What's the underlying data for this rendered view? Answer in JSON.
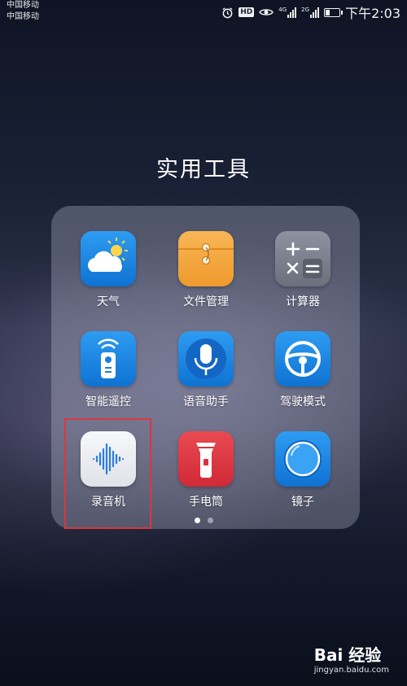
{
  "status_bar": {
    "carrier_1": "中国移动",
    "carrier_2": "中国移动",
    "hd": "HD",
    "net_1": "4G",
    "net_2": "2G",
    "time": "下午2:03",
    "battery_level": 0.35
  },
  "folder": {
    "title": "实用工具",
    "apps": [
      {
        "label": "天气",
        "icon": "weather-icon"
      },
      {
        "label": "文件管理",
        "icon": "file-manager-icon"
      },
      {
        "label": "计算器",
        "icon": "calculator-icon"
      },
      {
        "label": "智能遥控",
        "icon": "remote-control-icon"
      },
      {
        "label": "语音助手",
        "icon": "microphone-icon"
      },
      {
        "label": "驾驶模式",
        "icon": "steering-wheel-icon"
      },
      {
        "label": "录音机",
        "icon": "sound-recorder-icon"
      },
      {
        "label": "手电筒",
        "icon": "flashlight-icon"
      },
      {
        "label": "镜子",
        "icon": "mirror-icon"
      }
    ],
    "page_count": 2,
    "current_page": 1
  },
  "watermark": {
    "brand": "Bai 经验",
    "url": "jingyan.baidu.com"
  }
}
